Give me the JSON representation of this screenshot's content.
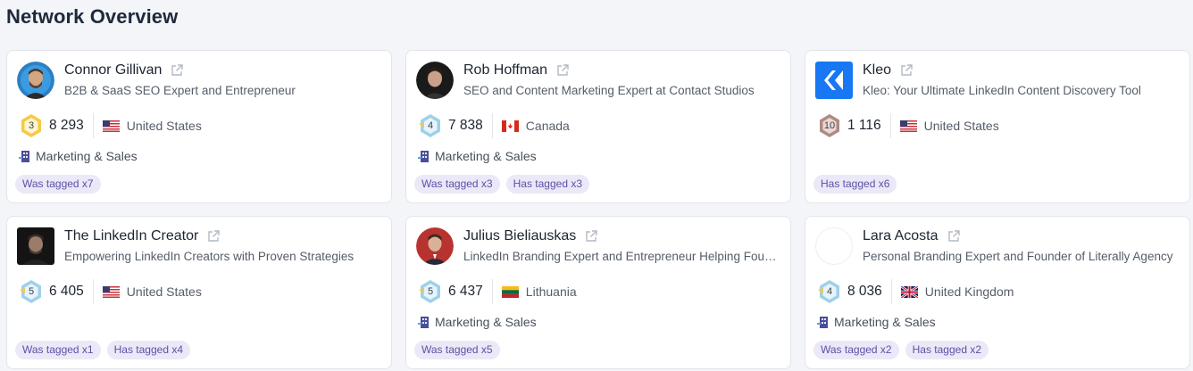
{
  "page": {
    "title": "Network Overview"
  },
  "cards": [
    {
      "name": "Connor Gillivan",
      "headline": "B2B & SaaS SEO Expert and Entrepreneur",
      "level": "3",
      "followers": "8 293",
      "country": "United States",
      "flag": "us-flag-icon",
      "category": "Marketing & Sales",
      "tags": [
        "Was tagged x7"
      ]
    },
    {
      "name": "Rob Hoffman",
      "headline": "SEO and Content Marketing Expert at Contact Studios",
      "level": "4",
      "followers": "7 838",
      "country": "Canada",
      "flag": "canada-flag-icon",
      "category": "Marketing & Sales",
      "tags": [
        "Was tagged x3",
        "Has tagged x3"
      ]
    },
    {
      "name": "Kleo",
      "headline": "Kleo: Your Ultimate LinkedIn Content Discovery Tool",
      "level": "10",
      "followers": "1 116",
      "country": "United States",
      "flag": "us-flag-icon",
      "category": "",
      "tags": [
        "Has tagged x6"
      ]
    },
    {
      "name": "The LinkedIn Creator",
      "headline": "Empowering LinkedIn Creators with Proven Strategies",
      "level": "5",
      "followers": "6 405",
      "country": "United States",
      "flag": "us-flag-icon",
      "category": "",
      "tags": [
        "Was tagged x1",
        "Has tagged x4"
      ]
    },
    {
      "name": "Julius Bieliauskas",
      "headline": "LinkedIn Branding Expert and Entrepreneur Helping Founders",
      "level": "5",
      "followers": "6 437",
      "country": "Lithuania",
      "flag": "lithuania-flag-icon",
      "category": "Marketing & Sales",
      "tags": [
        "Was tagged x5"
      ]
    },
    {
      "name": "Lara Acosta",
      "headline": "Personal Branding Expert and Founder of Literally Agency",
      "level": "4",
      "followers": "8 036",
      "country": "United Kingdom",
      "flag": "uk-flag-icon",
      "category": "Marketing & Sales",
      "tags": [
        "Was tagged x2",
        "Has tagged x2"
      ]
    }
  ],
  "colors": {
    "tag_bg": "#ebe8f7",
    "tag_text": "#5a52a6",
    "kleo_brand": "#1877f2"
  }
}
